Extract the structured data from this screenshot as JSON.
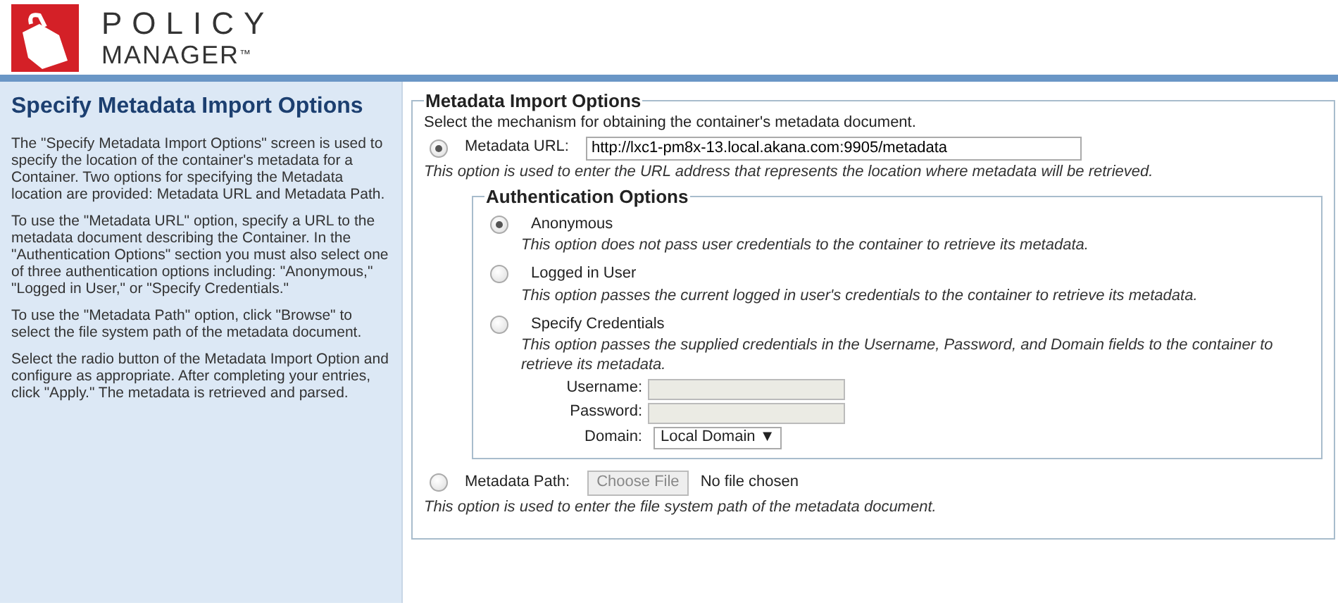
{
  "logo": {
    "line_1": "POLICY",
    "line_2": "MANAGER",
    "trademark": "™"
  },
  "sidebar": {
    "title": "Specify Metadata Import Options",
    "paragraphs": [
      "The \"Specify Metadata Import Options\" screen is used to specify the location of the container's metadata for a Container. Two options for specifying the Metadata location are provided: Metadata URL and Metadata Path.",
      "To use the \"Metadata URL\" option, specify a URL to the metadata document describing the Container. In the \"Authentication Options\" section you must also select one of three authentication options including: \"Anonymous,\" \"Logged in User,\" or \"Specify Credentials.\"",
      "To use the \"Metadata Path\" option, click \"Browse\" to select the file system path of the metadata document.",
      "Select the radio button of the Metadata Import Option and configure as appropriate. After completing your entries, click \"Apply.\" The metadata is retrieved and parsed."
    ]
  },
  "import_options": {
    "legend": "Metadata Import Options",
    "intro": "Select the mechanism for obtaining the container's metadata document.",
    "url_option": {
      "label": "Metadata URL:",
      "value": "http://lxc1-pm8x-13.local.akana.com:9905/metadata",
      "selected": true,
      "help": "This option is used to enter the URL address that represents the location where metadata will be retrieved."
    },
    "authentication": {
      "legend": "Authentication Options",
      "options": [
        {
          "label": "Anonymous",
          "selected": true,
          "description": "This option does not pass user credentials to the container to retrieve its metadata."
        },
        {
          "label": "Logged in User",
          "selected": false,
          "description": "This option passes the current logged in user's credentials to the container to retrieve its metadata."
        },
        {
          "label": "Specify Credentials",
          "selected": false,
          "description": "This option passes the supplied credentials in the Username, Password, and Domain fields to the container to retrieve its metadata."
        }
      ],
      "fields": [
        {
          "kind": "text",
          "label": "Username:",
          "disabled": true
        },
        {
          "kind": "text",
          "label": "Password:",
          "disabled": true
        },
        {
          "kind": "select",
          "label": "Domain:",
          "value": "Local Domain",
          "caret": "▼"
        }
      ]
    },
    "path_option": {
      "label": "Metadata Path:",
      "button": "Choose File",
      "file_status": "No file chosen",
      "selected": false,
      "help": "This option is used to enter the file system path of the metadata document."
    }
  }
}
